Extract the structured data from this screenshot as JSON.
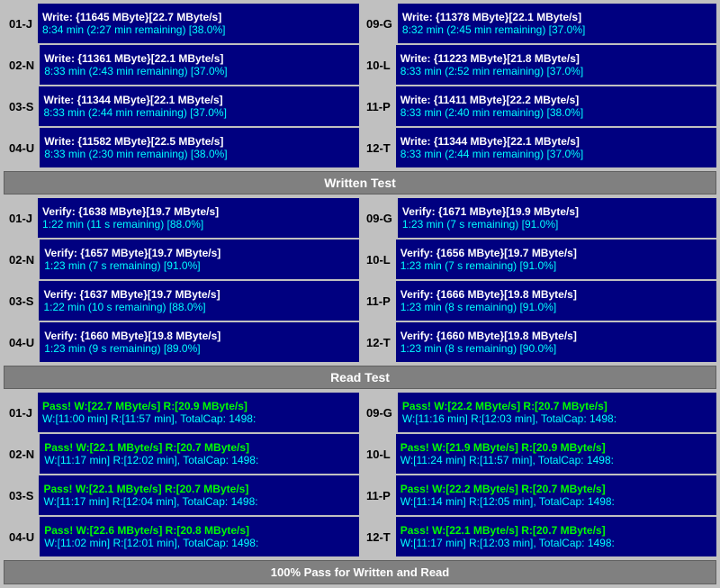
{
  "sections": {
    "write_test": {
      "label": "Written Test",
      "left": [
        {
          "id": "01-J",
          "line1": "Write: {11645 MByte}[22.7 MByte/s]",
          "line2": "8:34 min (2:27 min remaining)  [38.0%]"
        },
        {
          "id": "02-N",
          "line1": "Write: {11361 MByte}[22.1 MByte/s]",
          "line2": "8:33 min (2:43 min remaining)  [37.0%]"
        },
        {
          "id": "03-S",
          "line1": "Write: {11344 MByte}[22.1 MByte/s]",
          "line2": "8:33 min (2:44 min remaining)  [37.0%]"
        },
        {
          "id": "04-U",
          "line1": "Write: {11582 MByte}[22.5 MByte/s]",
          "line2": "8:33 min (2:30 min remaining)  [38.0%]"
        }
      ],
      "right": [
        {
          "id": "09-G",
          "line1": "Write: {11378 MByte}[22.1 MByte/s]",
          "line2": "8:32 min (2:45 min remaining)  [37.0%]"
        },
        {
          "id": "10-L",
          "line1": "Write: {11223 MByte}[21.8 MByte/s]",
          "line2": "8:33 min (2:52 min remaining)  [37.0%]"
        },
        {
          "id": "11-P",
          "line1": "Write: {11411 MByte}[22.2 MByte/s]",
          "line2": "8:33 min (2:40 min remaining)  [38.0%]"
        },
        {
          "id": "12-T",
          "line1": "Write: {11344 MByte}[22.1 MByte/s]",
          "line2": "8:33 min (2:44 min remaining)  [37.0%]"
        }
      ]
    },
    "verify_test": {
      "left": [
        {
          "id": "01-J",
          "line1": "Verify: {1638 MByte}[19.7 MByte/s]",
          "line2": "1:22 min (11 s remaining)   [88.0%]"
        },
        {
          "id": "02-N",
          "line1": "Verify: {1657 MByte}[19.7 MByte/s]",
          "line2": "1:23 min (7 s remaining)   [91.0%]"
        },
        {
          "id": "03-S",
          "line1": "Verify: {1637 MByte}[19.7 MByte/s]",
          "line2": "1:22 min (10 s remaining)   [88.0%]"
        },
        {
          "id": "04-U",
          "line1": "Verify: {1660 MByte}[19.8 MByte/s]",
          "line2": "1:23 min (9 s remaining)   [89.0%]"
        }
      ],
      "right": [
        {
          "id": "09-G",
          "line1": "Verify: {1671 MByte}[19.9 MByte/s]",
          "line2": "1:23 min (7 s remaining)   [91.0%]"
        },
        {
          "id": "10-L",
          "line1": "Verify: {1656 MByte}[19.7 MByte/s]",
          "line2": "1:23 min (7 s remaining)   [91.0%]"
        },
        {
          "id": "11-P",
          "line1": "Verify: {1666 MByte}[19.8 MByte/s]",
          "line2": "1:23 min (8 s remaining)   [91.0%]"
        },
        {
          "id": "12-T",
          "line1": "Verify: {1660 MByte}[19.8 MByte/s]",
          "line2": "1:23 min (8 s remaining)   [90.0%]"
        }
      ]
    },
    "read_test": {
      "label": "Read Test",
      "left": [
        {
          "id": "01-J",
          "line1": "Pass! W:[22.7 MByte/s] R:[20.9 MByte/s]",
          "line2": "W:[11:00 min] R:[11:57 min], TotalCap: 1498:"
        },
        {
          "id": "02-N",
          "line1": "Pass! W:[22.1 MByte/s] R:[20.7 MByte/s]",
          "line2": "W:[11:17 min] R:[12:02 min], TotalCap: 1498:"
        },
        {
          "id": "03-S",
          "line1": "Pass! W:[22.1 MByte/s] R:[20.7 MByte/s]",
          "line2": "W:[11:17 min] R:[12:04 min], TotalCap: 1498:"
        },
        {
          "id": "04-U",
          "line1": "Pass! W:[22.6 MByte/s] R:[20.8 MByte/s]",
          "line2": "W:[11:02 min] R:[12:01 min], TotalCap: 1498:"
        }
      ],
      "right": [
        {
          "id": "09-G",
          "line1": "Pass! W:[22.2 MByte/s] R:[20.7 MByte/s]",
          "line2": "W:[11:16 min] R:[12:03 min], TotalCap: 1498:"
        },
        {
          "id": "10-L",
          "line1": "Pass! W:[21.9 MByte/s] R:[20.9 MByte/s]",
          "line2": "W:[11:24 min] R:[11:57 min], TotalCap: 1498:"
        },
        {
          "id": "11-P",
          "line1": "Pass! W:[22.2 MByte/s] R:[20.7 MByte/s]",
          "line2": "W:[11:14 min] R:[12:05 min], TotalCap: 1498:"
        },
        {
          "id": "12-T",
          "line1": "Pass! W:[22.1 MByte/s] R:[20.7 MByte/s]",
          "line2": "W:[11:17 min] R:[12:03 min], TotalCap: 1498:"
        }
      ]
    }
  },
  "labels": {
    "written_test": "Written Test",
    "read_test": "Read Test",
    "status": "100% Pass for Written and Read"
  }
}
